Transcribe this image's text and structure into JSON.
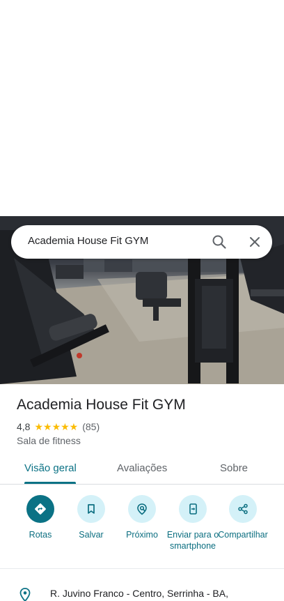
{
  "search": {
    "query": "Academia House Fit GYM"
  },
  "place": {
    "name": "Academia House Fit GYM",
    "rating": "4,8",
    "stars": "★★★★★",
    "reviews": "(85)",
    "category": "Sala de fitness"
  },
  "tabs": [
    {
      "label": "Visão geral",
      "active": true
    },
    {
      "label": "Avaliações",
      "active": false
    },
    {
      "label": "Sobre",
      "active": false
    }
  ],
  "actions": [
    {
      "label": "Rotas",
      "icon": "directions-icon"
    },
    {
      "label": "Salvar",
      "icon": "bookmark-icon"
    },
    {
      "label": "Próximo",
      "icon": "nearby-icon"
    },
    {
      "label": "Enviar para o smartphone",
      "icon": "send-to-phone-icon"
    },
    {
      "label": "Compartilhar",
      "icon": "share-icon"
    }
  ],
  "address": "R. Juvino Franco - Centro, Serrinha - BA,",
  "colors": {
    "accent": "#0b7285",
    "accent_light": "#d4f1f8",
    "star": "#fbbc04"
  }
}
